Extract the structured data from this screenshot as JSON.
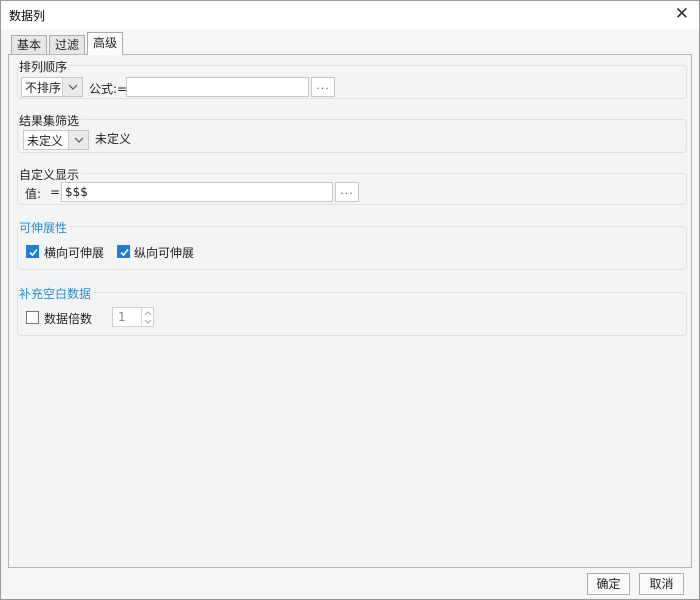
{
  "window": {
    "title": "数据列",
    "close_icon": "close-icon"
  },
  "tabs": [
    {
      "label": "基本"
    },
    {
      "label": "过滤"
    },
    {
      "label": "高级",
      "active": true
    }
  ],
  "sort": {
    "group_label": "排列顺序",
    "order_value": "不排序",
    "formula_label": "公式:=",
    "formula_value": "",
    "ellipsis": "..."
  },
  "filter": {
    "group_label": "结果集筛选",
    "mode_value": "未定义",
    "mode_text": "未定义"
  },
  "display": {
    "group_label": "自定义显示",
    "value_label": "值:",
    "equals": "=",
    "value": "$$$",
    "ellipsis": "..."
  },
  "extensibility": {
    "group_label": "可伸展性",
    "horizontal_label": "横向可伸展",
    "horizontal_checked": true,
    "vertical_label": "纵向可伸展",
    "vertical_checked": true
  },
  "padding": {
    "group_label": "补充空白数据",
    "multiple_label": "数据倍数",
    "multiple_checked": false,
    "multiple_value": "1"
  },
  "footer": {
    "ok_label": "确定",
    "cancel_label": "取消"
  },
  "colors": {
    "accent": "#1f8fd6",
    "checkbox": "#1f7fd6"
  }
}
